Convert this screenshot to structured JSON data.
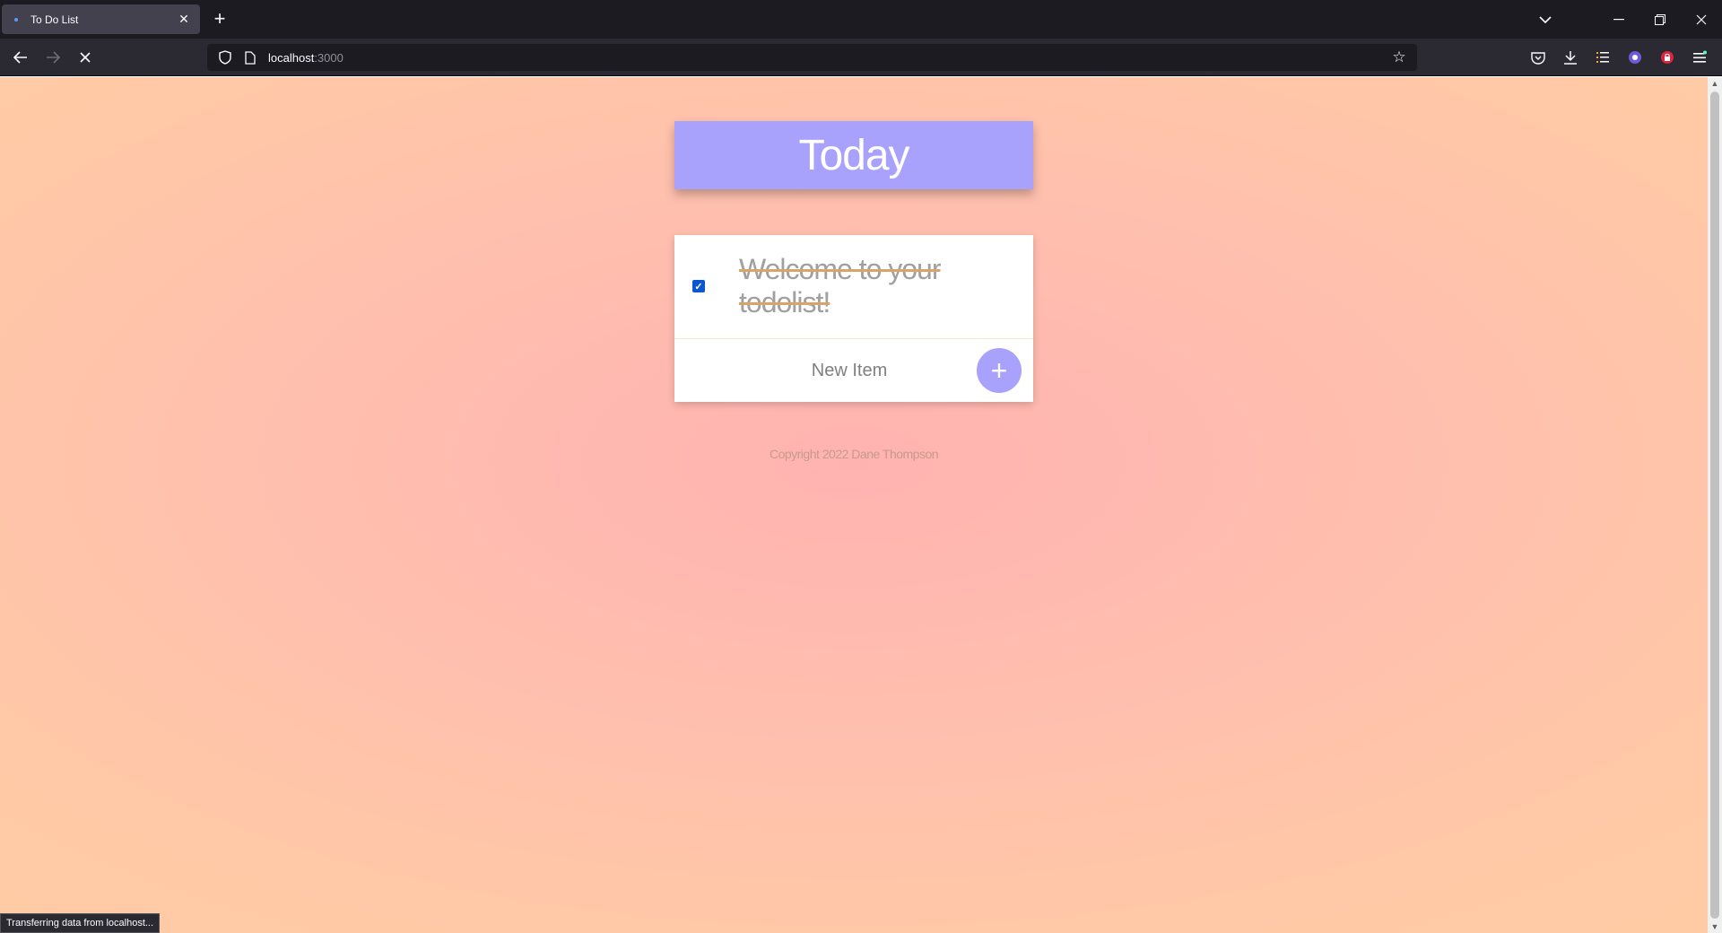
{
  "browser": {
    "tab_title": "To Do List",
    "tab_close": "✕",
    "new_tab": "+",
    "url_host": "localhost",
    "url_port": ":3000",
    "status_text": "Transferring data from localhost..."
  },
  "page": {
    "heading": "Today",
    "items": [
      {
        "label": "Welcome to your todolist!",
        "checked": true
      }
    ],
    "new_item_placeholder": "New Item",
    "add_button_label": "+",
    "footer": "Copyright 2022 Dane Thompson"
  },
  "colors": {
    "accent": "#a8a2fc",
    "checkbox": "#0b57d0"
  }
}
